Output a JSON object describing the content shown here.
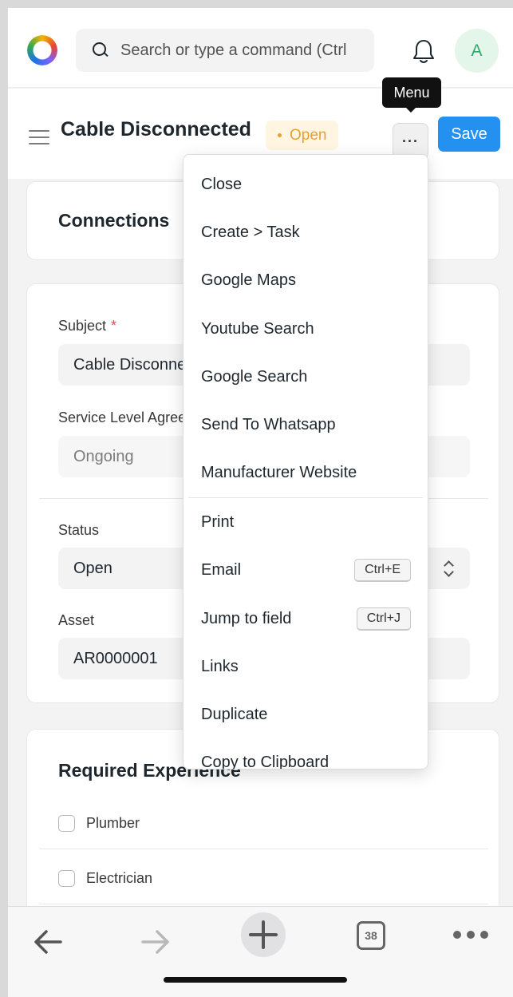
{
  "navbar": {
    "search_placeholder": "Search or type a command (Ctrl",
    "avatar_initial": "A"
  },
  "page": {
    "title": "Cable Disconnected",
    "status": "Open",
    "menu_button": "···",
    "menu_tooltip": "Menu",
    "save_label": "Save"
  },
  "connections": {
    "heading": "Connections"
  },
  "form": {
    "subject_label": "Subject",
    "subject_required": "*",
    "subject_value": "Cable Disconnected",
    "sla_label": "Service Level Agreement Status",
    "sla_value": "Ongoing",
    "status_label": "Status",
    "status_value": "Open",
    "asset_label": "Asset",
    "asset_value": "AR0000001"
  },
  "experience": {
    "heading": "Required Experience",
    "options": [
      "Plumber",
      "Electrician"
    ]
  },
  "menu": {
    "items": [
      "Close",
      "Create > Task",
      "Google Maps",
      "Youtube Search",
      "Google Search",
      "Send To Whatsapp",
      "Manufacturer Website",
      "Print",
      "Email",
      "Jump to field",
      "Links",
      "Duplicate",
      "Copy to Clipboard"
    ],
    "shortcuts": {
      "email": "Ctrl+E",
      "jump": "Ctrl+J"
    }
  },
  "browser": {
    "tab_count": "38"
  },
  "colors": {
    "primary": "#2490ef",
    "status_open_bg": "#fff5e0",
    "status_open_text": "#e2a235"
  }
}
